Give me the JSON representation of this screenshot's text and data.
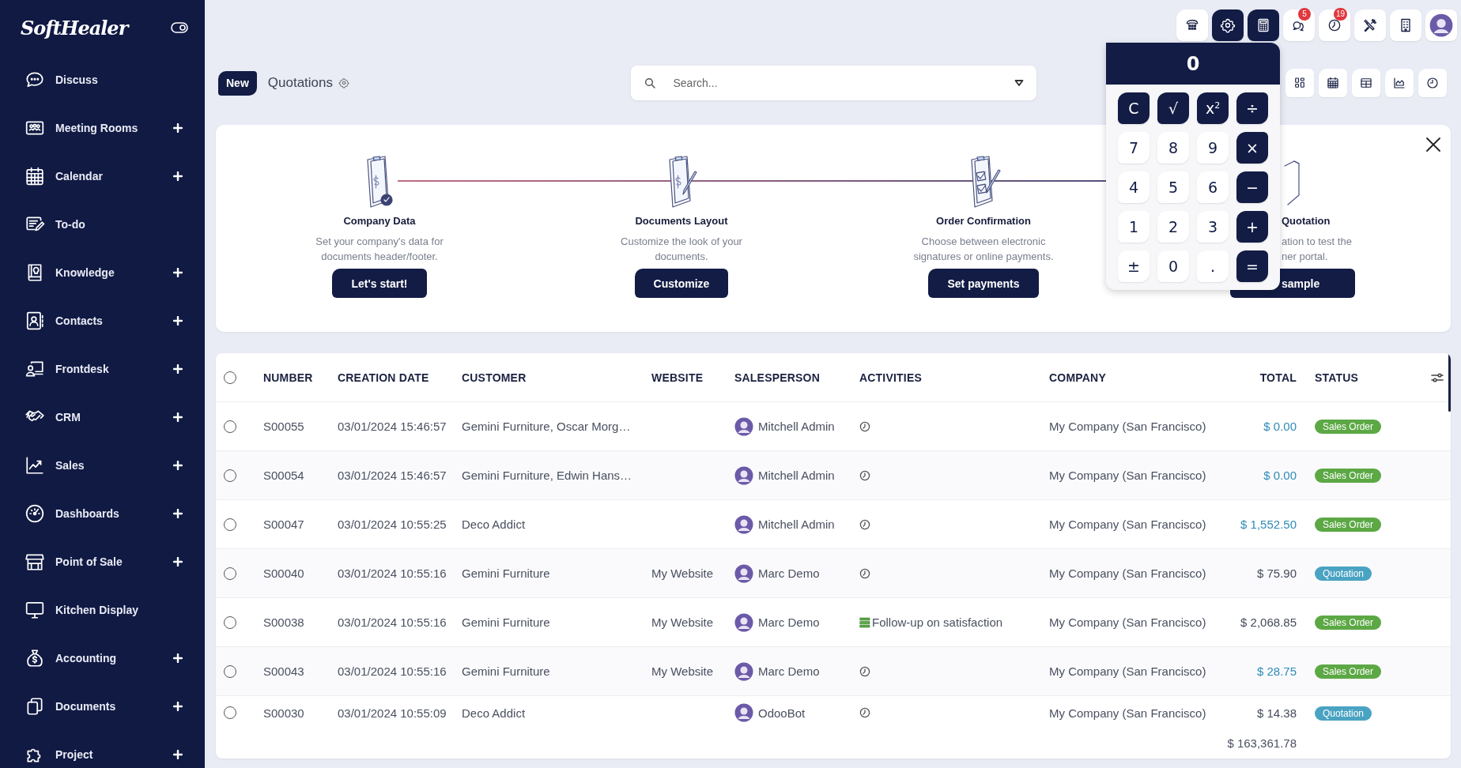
{
  "sidebar": {
    "logo": "SoftHealer",
    "items": [
      {
        "label": "Discuss",
        "expandable": false
      },
      {
        "label": "Meeting Rooms",
        "expandable": true
      },
      {
        "label": "Calendar",
        "expandable": true
      },
      {
        "label": "To-do",
        "expandable": false
      },
      {
        "label": "Knowledge",
        "expandable": true
      },
      {
        "label": "Contacts",
        "expandable": true
      },
      {
        "label": "Frontdesk",
        "expandable": true
      },
      {
        "label": "CRM",
        "expandable": true
      },
      {
        "label": "Sales",
        "expandable": true
      },
      {
        "label": "Dashboards",
        "expandable": true
      },
      {
        "label": "Point of Sale",
        "expandable": true
      },
      {
        "label": "Kitchen Display",
        "expandable": false
      },
      {
        "label": "Accounting",
        "expandable": true
      },
      {
        "label": "Documents",
        "expandable": true
      },
      {
        "label": "Project",
        "expandable": true
      }
    ]
  },
  "topbar": {
    "icons": [
      {
        "selected": false
      },
      {
        "selected": true
      },
      {
        "selected": true
      },
      {
        "selected": false,
        "badge": "5"
      },
      {
        "selected": false,
        "badge": "19"
      },
      {
        "selected": false
      },
      {
        "selected": false
      },
      {
        "selected": false
      }
    ]
  },
  "control_panel": {
    "new_button": "New",
    "breadcrumb": "Quotations",
    "search": {
      "placeholder": "Search..."
    }
  },
  "onboarding": {
    "steps": [
      {
        "kind": "full",
        "title": "Company Data",
        "description_lines": [
          "Set your company's data for",
          "documents header/footer."
        ],
        "button": "Let's start!"
      },
      {
        "kind": "full",
        "title": "Documents Layout",
        "description_lines": [
          "Customize the look of your",
          "documents."
        ],
        "button": "Customize"
      },
      {
        "kind": "full",
        "title": "Order Confirmation",
        "description_lines": [
          "Choose between electronic",
          "signatures or online payments."
        ],
        "button": "Set payments"
      },
      {
        "kind": "covered",
        "title": "Quotation",
        "description_lines": [
          "ation to test the",
          "ner portal."
        ],
        "button": "sample"
      }
    ]
  },
  "calculator": {
    "display": "0",
    "keys": [
      {
        "label": "C",
        "kind": "function"
      },
      {
        "label": "√",
        "kind": "function"
      },
      {
        "label": "x$^{2}$",
        "kind": "function"
      },
      {
        "label": "÷",
        "kind": "function"
      },
      {
        "label": "7",
        "kind": "digit"
      },
      {
        "label": "8",
        "kind": "digit"
      },
      {
        "label": "9",
        "kind": "digit"
      },
      {
        "label": "×",
        "kind": "function"
      },
      {
        "label": "4",
        "kind": "digit"
      },
      {
        "label": "5",
        "kind": "digit"
      },
      {
        "label": "6",
        "kind": "digit"
      },
      {
        "label": "−",
        "kind": "function"
      },
      {
        "label": "1",
        "kind": "digit"
      },
      {
        "label": "2",
        "kind": "digit"
      },
      {
        "label": "3",
        "kind": "digit"
      },
      {
        "label": "+",
        "kind": "function"
      },
      {
        "label": "±",
        "kind": "digit"
      },
      {
        "label": "0",
        "kind": "digit"
      },
      {
        "label": ".",
        "kind": "digit"
      },
      {
        "label": "=",
        "kind": "function"
      }
    ]
  },
  "table": {
    "select_all": {
      "checked": false
    },
    "columns": [
      "NUMBER",
      "CREATION DATE",
      "CUSTOMER",
      "WEBSITE",
      "SALESPERSON",
      "ACTIVITIES",
      "COMPANY",
      "TOTAL",
      "STATUS"
    ],
    "rows": [
      {
        "selected": false,
        "number": "S00055",
        "creation_date": "03/01/2024 15:46:57",
        "customer": "Gemini Furniture, Oscar Morg…",
        "salesperson": "Mitchell Admin",
        "activity": {
          "kind": "clock"
        },
        "company": "My Company (San Francisco)",
        "total": {
          "text": "$ 0.00",
          "color": "#2f8bb8"
        },
        "status": {
          "label": "Sales Order",
          "color": "#5ca845"
        }
      },
      {
        "selected": false,
        "number": "S00054",
        "creation_date": "03/01/2024 15:46:57",
        "customer": "Gemini Furniture, Edwin Hans…",
        "salesperson": "Mitchell Admin",
        "activity": {
          "kind": "clock"
        },
        "company": "My Company (San Francisco)",
        "total": {
          "text": "$ 0.00",
          "color": "#2f8bb8"
        },
        "status": {
          "label": "Sales Order",
          "color": "#5ca845"
        }
      },
      {
        "selected": false,
        "number": "S00047",
        "creation_date": "03/01/2024 10:55:25",
        "customer": "Deco Addict",
        "salesperson": "Mitchell Admin",
        "activity": {
          "kind": "clock"
        },
        "company": "My Company (San Francisco)",
        "total": {
          "text": "$ 1,552.50",
          "color": "#2f8bb8"
        },
        "status": {
          "label": "Sales Order",
          "color": "#5ca845"
        }
      },
      {
        "selected": false,
        "number": "S00040",
        "creation_date": "03/01/2024 10:55:16",
        "customer": "Gemini Furniture",
        "website": "My Website",
        "salesperson": "Marc Demo",
        "activity": {
          "kind": "clock"
        },
        "company": "My Company (San Francisco)",
        "total": {
          "text": "$ 75.90",
          "color": "#444b5a"
        },
        "status": {
          "label": "Quotation",
          "color": "#4aa3c2"
        }
      },
      {
        "selected": false,
        "number": "S00038",
        "creation_date": "03/01/2024 10:55:16",
        "customer": "Gemini Furniture",
        "website": "My Website",
        "salesperson": "Marc Demo",
        "activity": {
          "kind": "task",
          "label": "Follow-up on satisfaction"
        },
        "company": "My Company (San Francisco)",
        "total": {
          "text": "$ 2,068.85",
          "color": "#444b5a"
        },
        "status": {
          "label": "Sales Order",
          "color": "#5ca845"
        }
      },
      {
        "selected": false,
        "number": "S00043",
        "creation_date": "03/01/2024 10:55:16",
        "customer": "Gemini Furniture",
        "website": "My Website",
        "salesperson": "Marc Demo",
        "activity": {
          "kind": "clock"
        },
        "company": "My Company (San Francisco)",
        "total": {
          "text": "$ 28.75",
          "color": "#2f8bb8"
        },
        "status": {
          "label": "Sales Order",
          "color": "#5ca845"
        }
      },
      {
        "selected": false,
        "number": "S00030",
        "creation_date": "03/01/2024 10:55:09",
        "customer": "Deco Addict",
        "salesperson": "OdooBot",
        "activity": {
          "kind": "clock"
        },
        "company": "My Company (San Francisco)",
        "total": {
          "text": "$ 14.38",
          "color": "#444b5a"
        },
        "status": {
          "label": "Quotation",
          "color": "#4aa3c2"
        }
      }
    ],
    "sum_total": "$ 163,361.78"
  }
}
